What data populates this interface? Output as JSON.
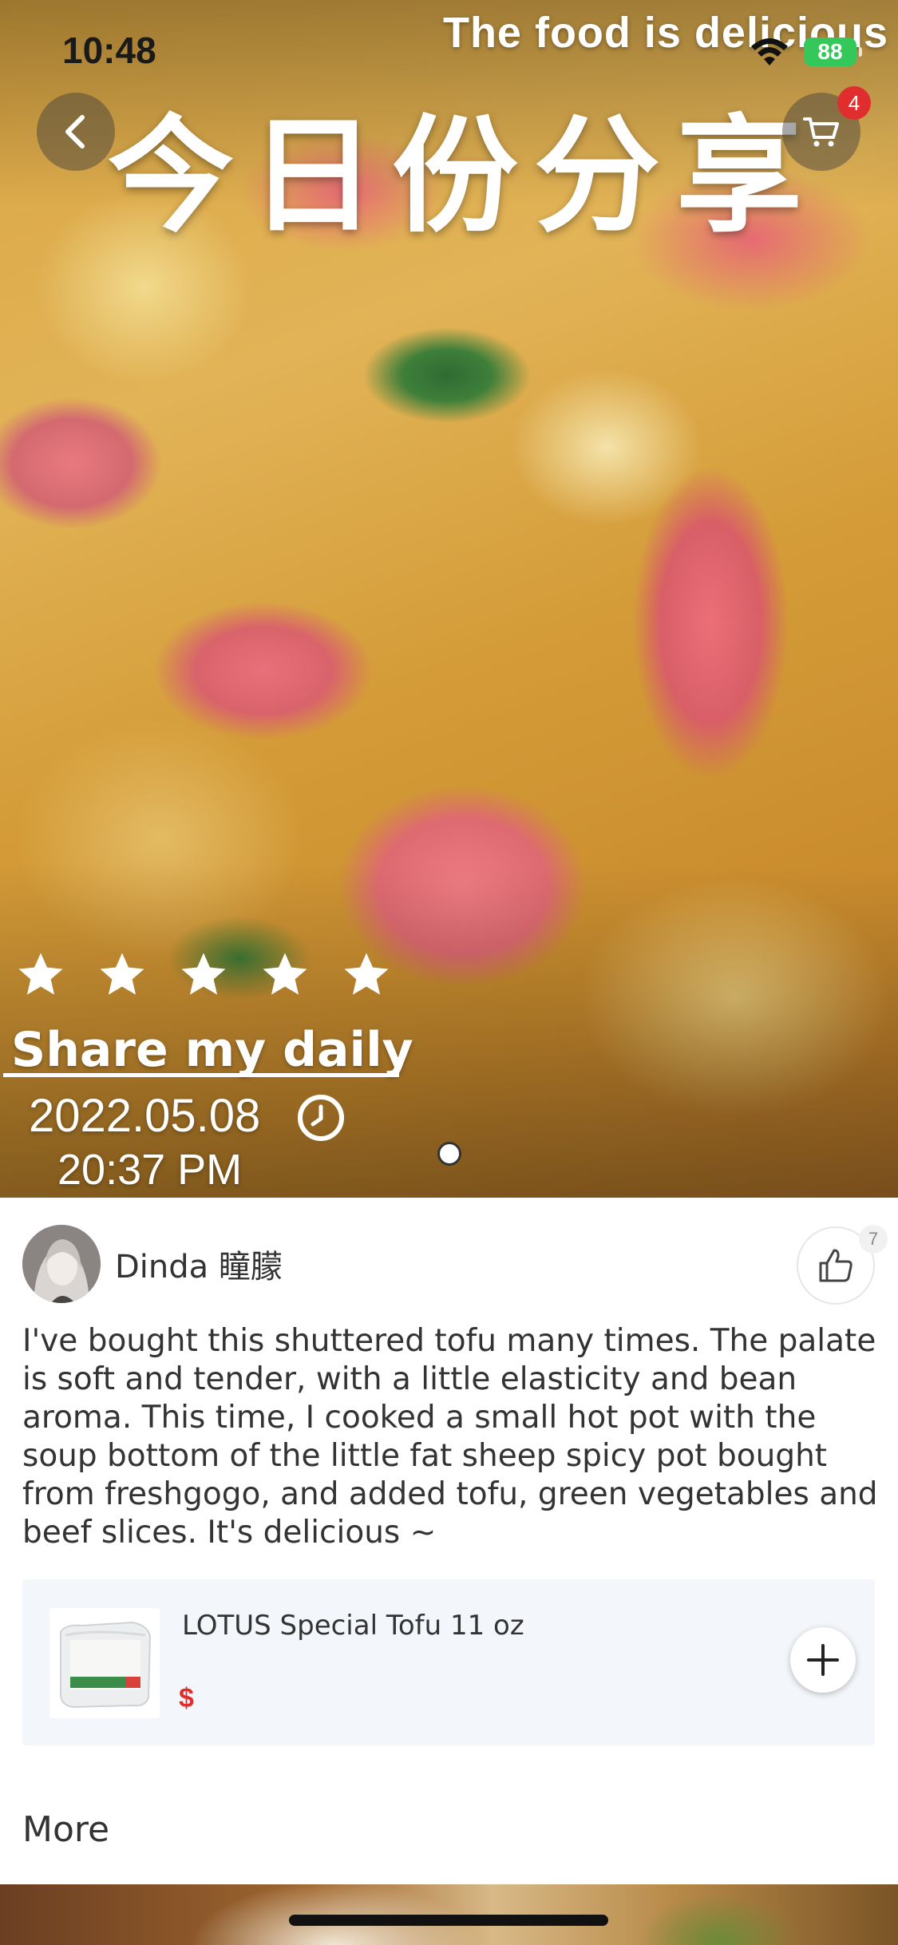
{
  "status_bar": {
    "time": "10:48",
    "battery": "88"
  },
  "hero": {
    "tagline": "The  food is delicious",
    "title": "今日份分享",
    "rating_stars": 5,
    "caption": "Share my daily",
    "date": "2022.05.08",
    "time": "20:37  PM"
  },
  "cart": {
    "badge_count": "4"
  },
  "author": {
    "name": "Dinda 瞳朦"
  },
  "likes": {
    "count": "7"
  },
  "post": {
    "text": "I've bought this shuttered tofu many times. The palate is soft and tender, with a little elasticity and bean aroma. This time, I cooked a small hot pot with the soup bottom of the little fat sheep spicy pot bought from freshgogo, and added tofu, green vegetables and beef slices. It's delicious ~"
  },
  "product": {
    "name": "LOTUS Special Tofu 11 oz",
    "price": "$"
  },
  "section": {
    "more_title": "More"
  },
  "colors": {
    "accent_red": "#e02e2e",
    "battery_green": "#34c759",
    "card_bg": "#f3f6fa"
  },
  "icons": [
    "back-icon",
    "cart-icon",
    "star-icon",
    "clock-icon",
    "thumbs-up-icon",
    "plus-icon",
    "wifi-icon"
  ]
}
